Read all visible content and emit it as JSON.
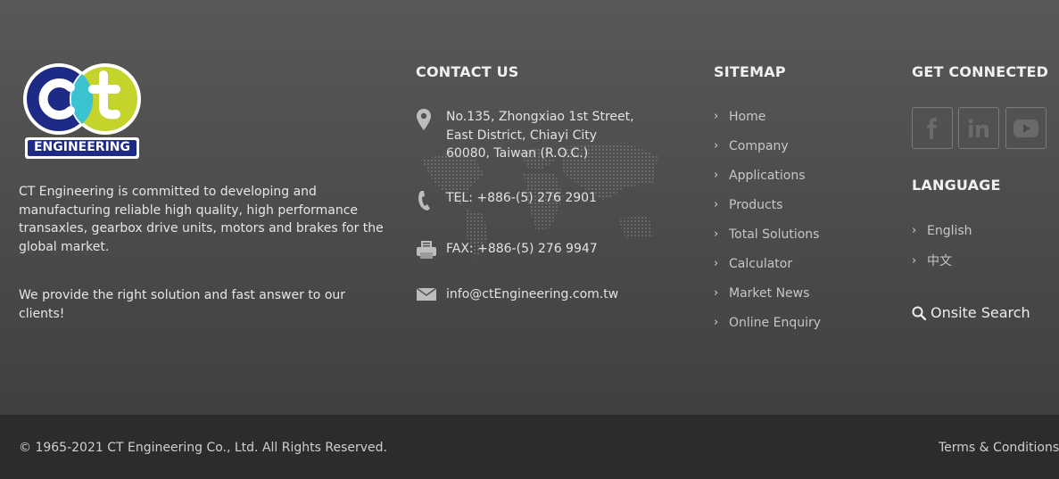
{
  "brand": {
    "logo_text": "ct",
    "logo_subtitle": "ENGINEERING",
    "colors": {
      "navy": "#1d2b87",
      "lime": "#c5d42a",
      "teal": "#3bc3d2"
    }
  },
  "about": {
    "paragraph_1": "CT Engineering is committed to developing and manufacturing reliable high quality, high performance transaxles, gearbox drive units, motors and brakes for the global market.",
    "paragraph_2": "We provide the right solution and fast answer to our clients!"
  },
  "contact": {
    "title": "CONTACT US",
    "address": [
      "No.135, Zhongxiao 1st Street,",
      "East District, Chiayi City",
      "60080, Taiwan (R.O.C.)"
    ],
    "tel": "TEL: +886-(5) 276 2901",
    "fax": "FAX: +886-(5) 276 9947",
    "email": "info@ctEngineering.com.tw",
    "icons": [
      "map-pin-icon",
      "phone-icon",
      "fax-icon",
      "envelope-icon"
    ]
  },
  "sitemap": {
    "title": "SITEMAP",
    "items": [
      "Home",
      "Company",
      "Applications",
      "Products",
      "Total Solutions",
      "Calculator",
      "Market News",
      "Online Enquiry"
    ]
  },
  "connect": {
    "title": "GET CONNECTED",
    "social": [
      "facebook-icon",
      "linkedin-icon",
      "youtube-icon"
    ]
  },
  "language": {
    "title": "LANGUAGE",
    "items": [
      "English",
      "中文"
    ]
  },
  "search": {
    "label": "Onsite Search"
  },
  "bottom": {
    "copyright": "© 1965-2021 CT Engineering Co., Ltd. All Rights Reserved.",
    "terms": "Terms & Conditions"
  }
}
